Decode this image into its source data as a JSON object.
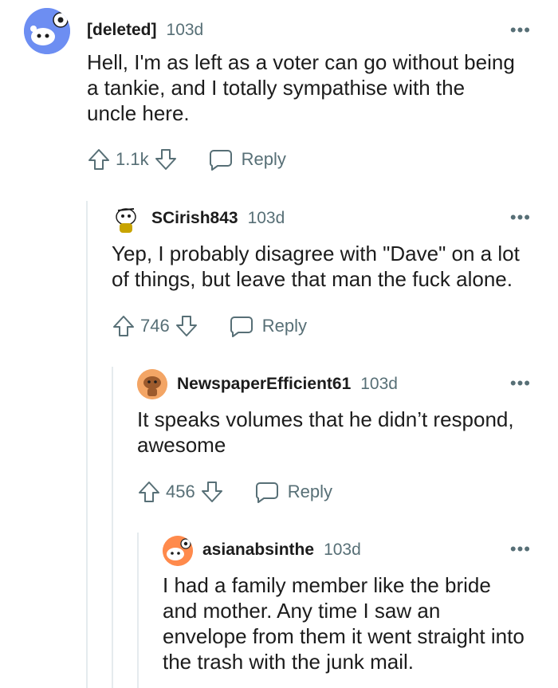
{
  "comments": [
    {
      "user": "[deleted]",
      "time": "103d",
      "more": "•••",
      "text": "Hell, I'm as left as a voter can go without being a tankie, and I totally sympathise with the uncle here.",
      "votes": "1.1k",
      "reply_label": "Reply"
    },
    {
      "user": "SCirish843",
      "time": "103d",
      "more": "•••",
      "text": "Yep, I probably disagree with \"Dave\" on a lot of things, but leave that man the fuck alone.",
      "votes": "746",
      "reply_label": "Reply"
    },
    {
      "user": "NewspaperEfficient61",
      "time": "103d",
      "more": "•••",
      "text": "It speaks volumes that he didn’t respond, awesome",
      "votes": "456",
      "reply_label": "Reply"
    },
    {
      "user": "asianabsinthe",
      "time": "103d",
      "more": "•••",
      "text": "I had a family member like the bride and mother. Any time I saw an envelope from them it went straight into the trash with the junk mail.",
      "votes": "",
      "reply_label": ""
    }
  ],
  "icons": {
    "upvote": "upvote-arrow-icon",
    "downvote": "downvote-arrow-icon",
    "reply": "speech-bubble-icon",
    "more": "ellipsis-icon"
  },
  "colors": {
    "meta": "#576f76",
    "thread_line": "#e5ebee",
    "avatar_blue": "#6b8ff0",
    "avatar_orange": "#ff8b4a",
    "avatar_tan": "#f4a460"
  }
}
